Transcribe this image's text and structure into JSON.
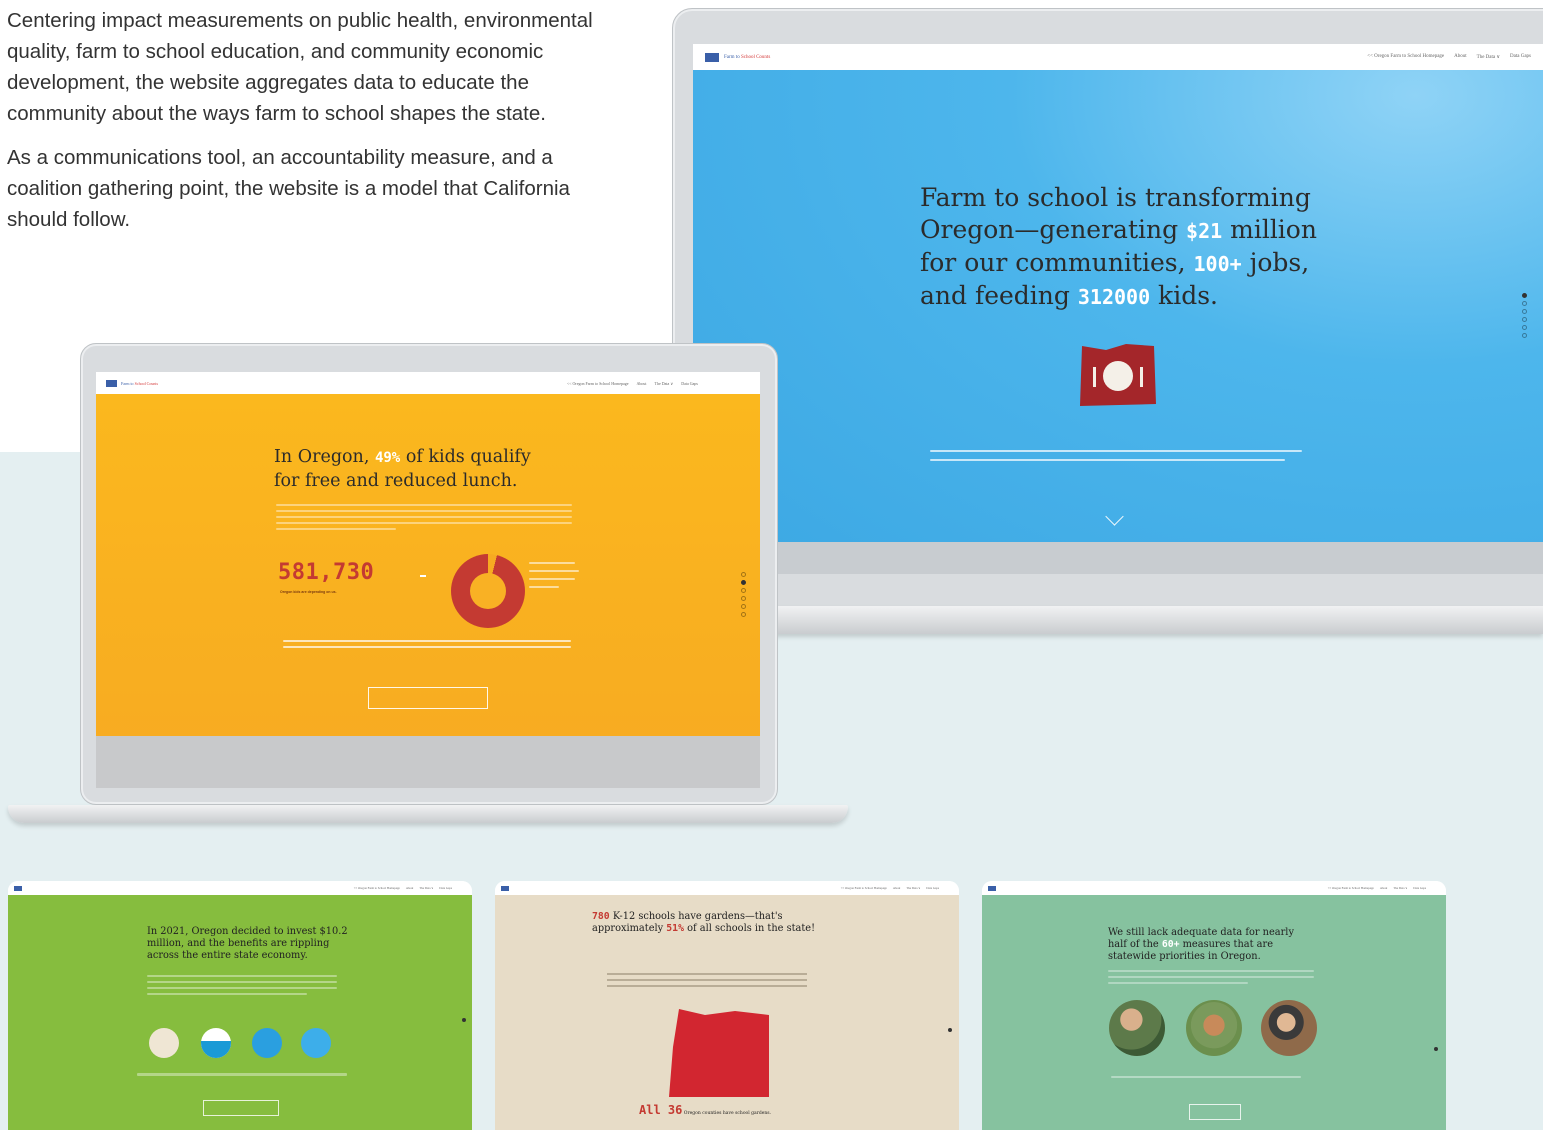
{
  "intro": {
    "paragraph1": "Centering impact measurements on public health, environmental quality, farm to school education, and community economic development, the website aggregates data to educate the community about the ways farm to school shapes the state.",
    "paragraph2": "As a communications tool, an accountability measure, and a coalition gathering point, the website is a model that California should follow."
  },
  "site": {
    "logo_word1": "Farm to",
    "logo_word2": " School Counts",
    "nav": [
      "<< Oregon Farm to School Homepage",
      "About",
      "The Data ∨",
      "Data Gaps"
    ]
  },
  "hero_blue": {
    "line1": "Farm to school is transforming",
    "line2a": "Oregon—generating ",
    "money": "$21",
    "line2b": " million",
    "line3a": "for our communities, ",
    "jobs": "100+",
    "line3b": " jobs,",
    "line4a": "and feeding ",
    "kids": "312000",
    "line4b": " kids."
  },
  "hero_orange": {
    "line1a": "In Oregon, ",
    "percent": "49%",
    "line1b": " of kids qualify",
    "line2": "for free and reduced lunch.",
    "big_number": "581,730",
    "big_number_label": "Oregon kids are depending on us."
  },
  "cards": [
    {
      "title": "In 2021, Oregon decided to invest $10.2 million, and the benefits are rippling across the entire state economy."
    },
    {
      "title_num": "780",
      "title_a": " K-12 schools have gardens—that's approximately ",
      "title_pct": "51%",
      "title_b": " of all schools in the state!",
      "footer_big": "All 36",
      "footer_rest": " Oregon counties have school gardens."
    },
    {
      "title_a": "We still lack adequate data for nearly half of the ",
      "title_num": "60+",
      "title_b": " measures that are statewide priorities in Oregon."
    }
  ],
  "colors": {
    "blue": "#3ba7e3",
    "orange": "#f7aa22",
    "green": "#86bd3e",
    "beige": "#e7dcc7",
    "teal": "#86c29f",
    "red": "#c43a32"
  }
}
